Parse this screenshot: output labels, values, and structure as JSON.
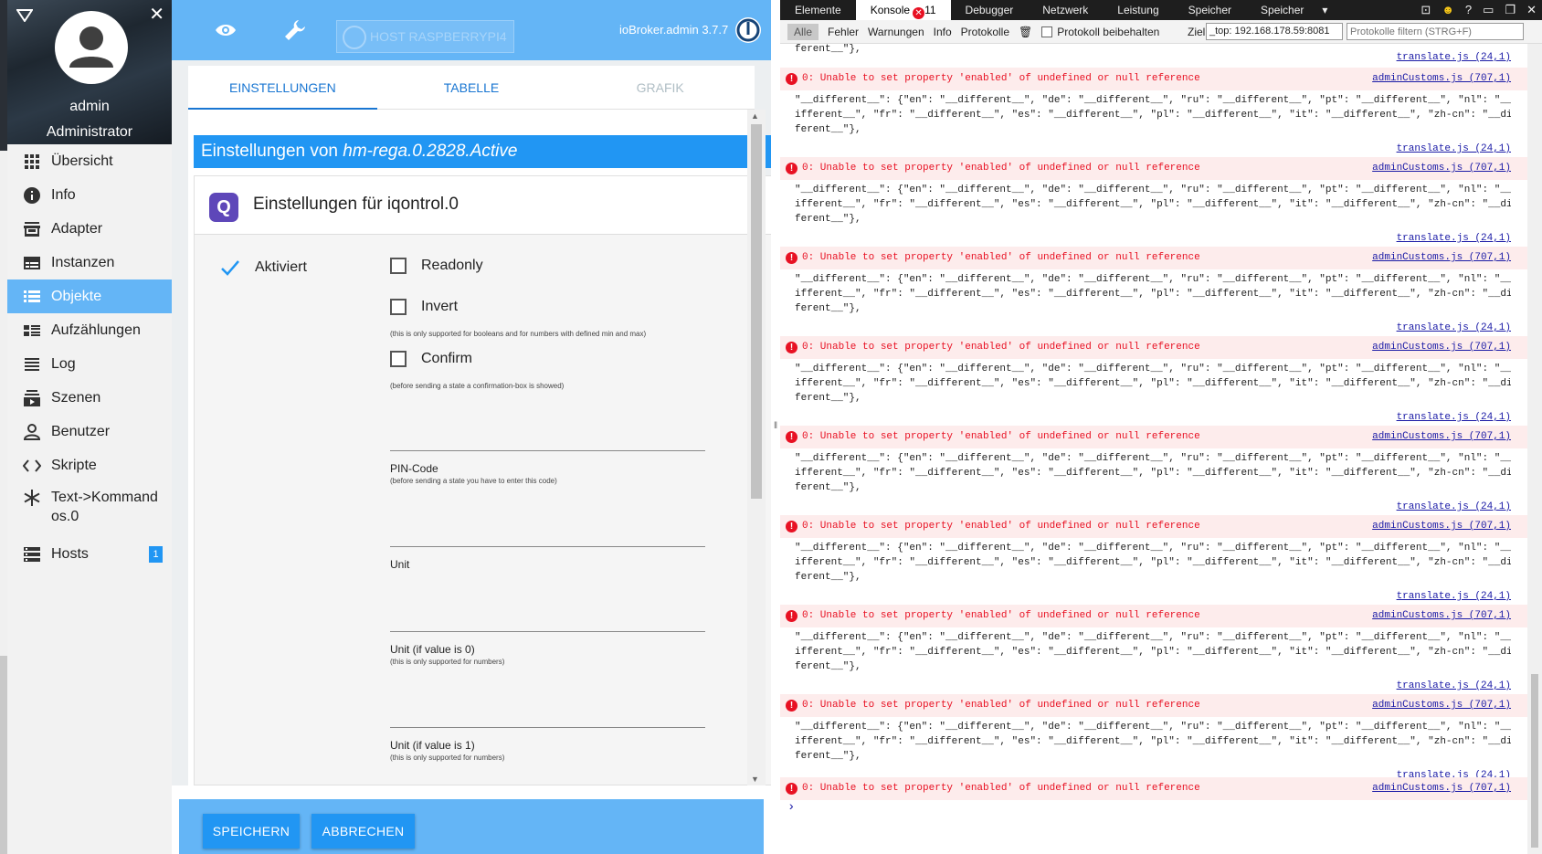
{
  "sidebar": {
    "user_name": "admin",
    "user_role": "Administrator",
    "items": [
      {
        "label": "Übersicht",
        "icon": "grid-icon"
      },
      {
        "label": "Info",
        "icon": "info-icon"
      },
      {
        "label": "Adapter",
        "icon": "store-icon"
      },
      {
        "label": "Instanzen",
        "icon": "card-icon"
      },
      {
        "label": "Objekte",
        "icon": "list-icon",
        "active": true
      },
      {
        "label": "Aufzählungen",
        "icon": "enum-icon"
      },
      {
        "label": "Log",
        "icon": "lines-icon"
      },
      {
        "label": "Szenen",
        "icon": "scenes-icon"
      },
      {
        "label": "Benutzer",
        "icon": "person-icon"
      },
      {
        "label": "Skripte",
        "icon": "code-icon"
      },
      {
        "label": "Text->Kommandos.0",
        "icon": "snowflake-icon"
      },
      {
        "label": "Hosts",
        "icon": "hosts-icon",
        "badge": "1"
      }
    ]
  },
  "topbar": {
    "host_label": "HOST RASPBERRYPI4",
    "version": "ioBroker.admin 3.7.7"
  },
  "tabs": [
    {
      "label": "EINSTELLUNGEN",
      "active": true
    },
    {
      "label": "TABELLE"
    },
    {
      "label": "GRAFIK",
      "disabled": true
    }
  ],
  "settings": {
    "title_prefix": "Einstellungen von ",
    "object_id": "hm-rega.0.2828.Active",
    "instance_title": "Einstellungen für iqontrol.0",
    "activated_label": "Aktiviert",
    "readonly_label": "Readonly",
    "invert_label": "Invert",
    "invert_hint": "(this is only supported for booleans and for numbers with defined min and max)",
    "confirm_label": "Confirm",
    "confirm_hint": "(before sending a state a confirmation-box is showed)",
    "pin_label": "PIN-Code",
    "pin_hint": "(before sending a state you have to enter this code)",
    "unit_label": "Unit",
    "unit0_label": "Unit (if value is 0)",
    "unit0_hint": "(this is only supported for numbers)",
    "unit1_label": "Unit (if value is 1)",
    "unit1_hint": "(this is only supported for numbers)"
  },
  "footer": {
    "save": "SPEICHERN",
    "cancel": "ABBRECHEN"
  },
  "devtools": {
    "tabs": [
      "Elemente",
      "Konsole",
      "Debugger",
      "Netzwerk",
      "Leistung",
      "Speicher",
      "Speicher"
    ],
    "error_count": "11",
    "filters": {
      "all": "Alle",
      "errors": "Fehler",
      "warnings": "Warnungen",
      "info": "Info",
      "logs": "Protokolle",
      "preserve": "Protokoll beibehalten",
      "target_label": "Ziel",
      "target_value": "_top: 192.168.178.59:8081",
      "filter_placeholder": "Protokolle filtern (STRG+F)"
    },
    "first_line": "ferent__\"},",
    "first_src": "translate.js (24,1)",
    "error_msg": "0: Unable to set property 'enabled' of undefined or null reference",
    "error_src": "adminCustoms.js (707,1)",
    "body_line1": "\"__different__\": {\"en\": \"__different__\", \"de\": \"__different__\", \"ru\": \"__different__\", \"pt\": \"__different__\", \"nl\": \"__d",
    "body_line2": "ifferent__\", \"fr\": \"__different__\", \"es\": \"__different__\", \"pl\": \"__different__\", \"it\": \"__different__\", \"zh-cn\": \"__dif",
    "body_line3": "ferent__\"},",
    "body_src": "translate.js (24,1)",
    "entries": 8,
    "prompt": "›"
  }
}
